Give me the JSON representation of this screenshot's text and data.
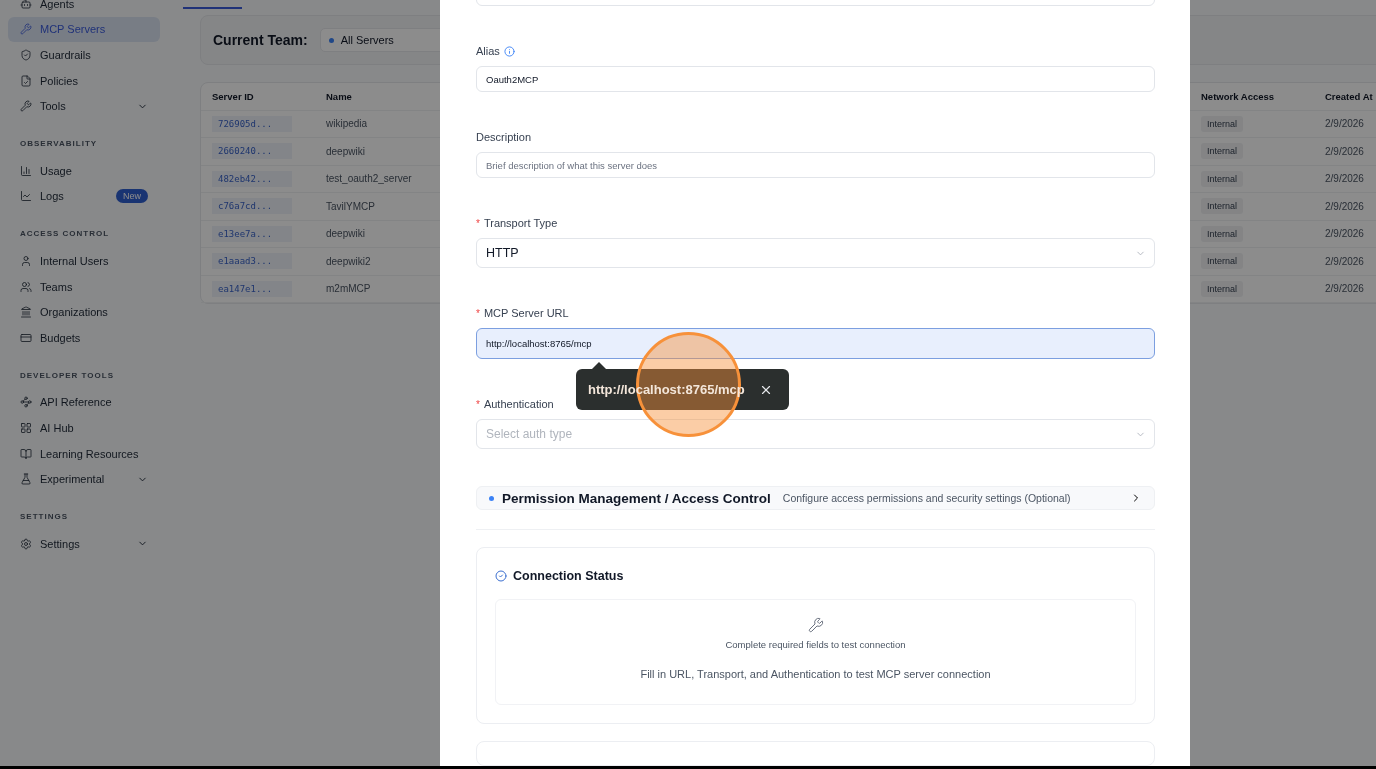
{
  "sidebar": {
    "items": [
      {
        "kind": "item",
        "label": "Agents",
        "selected": false,
        "expandable": false
      },
      {
        "kind": "item",
        "label": "MCP Servers",
        "selected": true,
        "expandable": false
      },
      {
        "kind": "item",
        "label": "Guardrails",
        "selected": false,
        "expandable": false
      },
      {
        "kind": "item",
        "label": "Policies",
        "selected": false,
        "expandable": false
      },
      {
        "kind": "item",
        "label": "Tools",
        "selected": false,
        "expandable": true
      },
      {
        "kind": "section",
        "label": "OBSERVABILITY"
      },
      {
        "kind": "item",
        "label": "Usage",
        "selected": false,
        "expandable": false
      },
      {
        "kind": "item",
        "label": "Logs",
        "selected": false,
        "expandable": false,
        "badge": "New"
      },
      {
        "kind": "section",
        "label": "ACCESS CONTROL"
      },
      {
        "kind": "item",
        "label": "Internal Users",
        "selected": false,
        "expandable": false
      },
      {
        "kind": "item",
        "label": "Teams",
        "selected": false,
        "expandable": false
      },
      {
        "kind": "item",
        "label": "Organizations",
        "selected": false,
        "expandable": false
      },
      {
        "kind": "item",
        "label": "Budgets",
        "selected": false,
        "expandable": false
      },
      {
        "kind": "section",
        "label": "DEVELOPER TOOLS"
      },
      {
        "kind": "item",
        "label": "API Reference",
        "selected": false,
        "expandable": false
      },
      {
        "kind": "item",
        "label": "AI Hub",
        "selected": false,
        "expandable": false
      },
      {
        "kind": "item",
        "label": "Learning Resources",
        "selected": false,
        "expandable": false
      },
      {
        "kind": "item",
        "label": "Experimental",
        "selected": false,
        "expandable": true
      },
      {
        "kind": "section",
        "label": "SETTINGS"
      },
      {
        "kind": "item",
        "label": "Settings",
        "selected": false,
        "expandable": true
      }
    ]
  },
  "team": {
    "label": "Current Team:",
    "value": "All Servers"
  },
  "table": {
    "columns": [
      "Server ID",
      "Name",
      "Network Access",
      "Created At"
    ],
    "rows": [
      {
        "server_id": "726905d...",
        "name": "wikipedia",
        "network_access": "Internal",
        "created_at": "2/9/2026"
      },
      {
        "server_id": "2660240...",
        "name": "deepwiki",
        "network_access": "Internal",
        "created_at": "2/9/2026"
      },
      {
        "server_id": "482eb42...",
        "name": "test_oauth2_server",
        "network_access": "Internal",
        "created_at": "2/9/2026"
      },
      {
        "server_id": "c76a7cd...",
        "name": "TavilYMCP",
        "network_access": "Internal",
        "created_at": "2/9/2026"
      },
      {
        "server_id": "e13ee7a...",
        "name": "deepwiki",
        "network_access": "Internal",
        "created_at": "2/9/2026"
      },
      {
        "server_id": "e1aaad3...",
        "name": "deepwiki2",
        "network_access": "Internal",
        "created_at": "2/9/2026"
      },
      {
        "server_id": "ea147e1...",
        "name": "m2mMCP",
        "network_access": "Internal",
        "created_at": "2/9/2026"
      }
    ]
  },
  "modal": {
    "fields": [
      {
        "kind": "input",
        "focused": false
      },
      {
        "kind": "input",
        "label": "Alias",
        "info": true,
        "focused": false,
        "value": "Oauth2MCP"
      },
      {
        "kind": "input",
        "label": "Description",
        "info": false,
        "focused": false,
        "placeholder": "Brief description of what this server does"
      },
      {
        "kind": "select",
        "label": "Transport Type",
        "required_mark": "*",
        "info": false,
        "value": "HTTP"
      },
      {
        "kind": "input",
        "label": "MCP Server URL",
        "required_mark": "*",
        "info": false,
        "focused": true,
        "value": "http://localhost:8765/mcp",
        "tooltip": "http://localhost:8765/mcp"
      },
      {
        "kind": "select",
        "label": "Authentication",
        "required_mark": "*",
        "info": false,
        "placeholder": "Select auth type"
      }
    ],
    "permission": {
      "title": "Permission Management / Access Control",
      "subtitle": "Configure access permissions and security settings (Optional)",
      "expanded": false
    },
    "connection": {
      "title": "Connection Status",
      "message": "Complete required fields to test connection",
      "hint": "Fill in URL, Transport, and Authentication to test MCP server connection"
    }
  }
}
